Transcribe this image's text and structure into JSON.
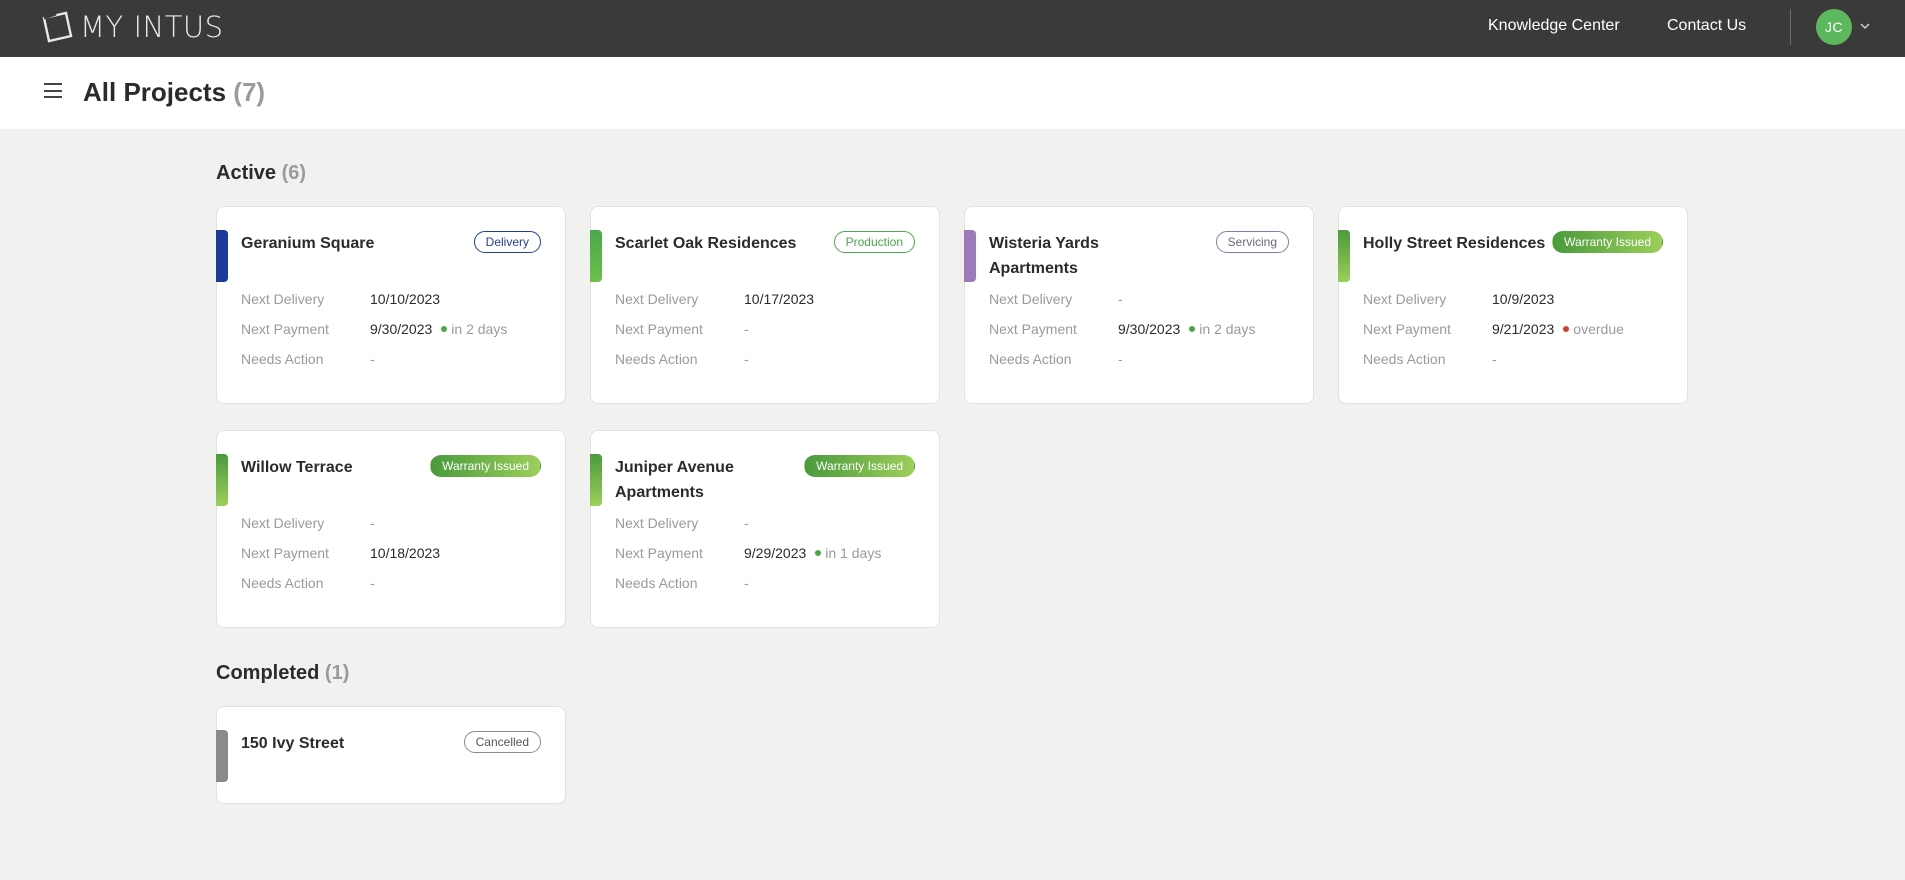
{
  "app": {
    "logo_text": "MY INTUS",
    "nav": {
      "knowledge": "Knowledge Center",
      "contact": "Contact Us"
    },
    "user_initials": "JC"
  },
  "header": {
    "title": "All Projects",
    "count": "(7)"
  },
  "labels": {
    "next_delivery": "Next Delivery",
    "next_payment": "Next Payment",
    "needs_action": "Needs Action"
  },
  "sections": {
    "active": {
      "title": "Active",
      "count": "(6)"
    },
    "completed": {
      "title": "Completed",
      "count": "(1)"
    }
  },
  "projects": [
    {
      "name": "Geranium Square",
      "status": "Delivery",
      "status_color": "#1f3f9a",
      "accent": "#1f3f9a",
      "next_delivery": "10/10/2023",
      "next_payment": "9/30/2023",
      "payment_note": "in 2 days",
      "payment_state": "ok",
      "needs_action": "-"
    },
    {
      "name": "Scarlet Oak Residences",
      "status": "Production",
      "status_color": "#4aa84a",
      "accent": "#4aa84a",
      "next_delivery": "10/17/2023",
      "next_payment": "-",
      "payment_note": "",
      "payment_state": "",
      "needs_action": "-"
    },
    {
      "name": "Wisteria Yards Apartments",
      "status": "Servicing",
      "status_color": "#8a7aa6",
      "accent": "#9b7bb8",
      "next_delivery": "-",
      "next_payment": "9/30/2023",
      "payment_note": "in 2 days",
      "payment_state": "ok",
      "needs_action": "-"
    },
    {
      "name": "Holly Street Residences",
      "status": "Warranty Issued",
      "status_color": "#4a9a3c",
      "accent": "#6ab04c",
      "next_delivery": "10/9/2023",
      "next_payment": "9/21/2023",
      "payment_note": "overdue",
      "payment_state": "bad",
      "needs_action": "-"
    },
    {
      "name": "Willow Terrace",
      "status": "Warranty Issued",
      "status_color": "#4a9a3c",
      "accent": "#6ab04c",
      "next_delivery": "-",
      "next_payment": "10/18/2023",
      "payment_note": "",
      "payment_state": "",
      "needs_action": "-"
    },
    {
      "name": "Juniper Avenue Apartments",
      "status": "Warranty Issued",
      "status_color": "#4a9a3c",
      "accent": "#6ab04c",
      "next_delivery": "-",
      "next_payment": "9/29/2023",
      "payment_note": "in 1 days",
      "payment_state": "ok",
      "needs_action": "-"
    },
    {
      "name": "150 Ivy Street",
      "status": "Cancelled",
      "status_color": "#8a8a8a",
      "accent": "#8a8a8a"
    }
  ]
}
